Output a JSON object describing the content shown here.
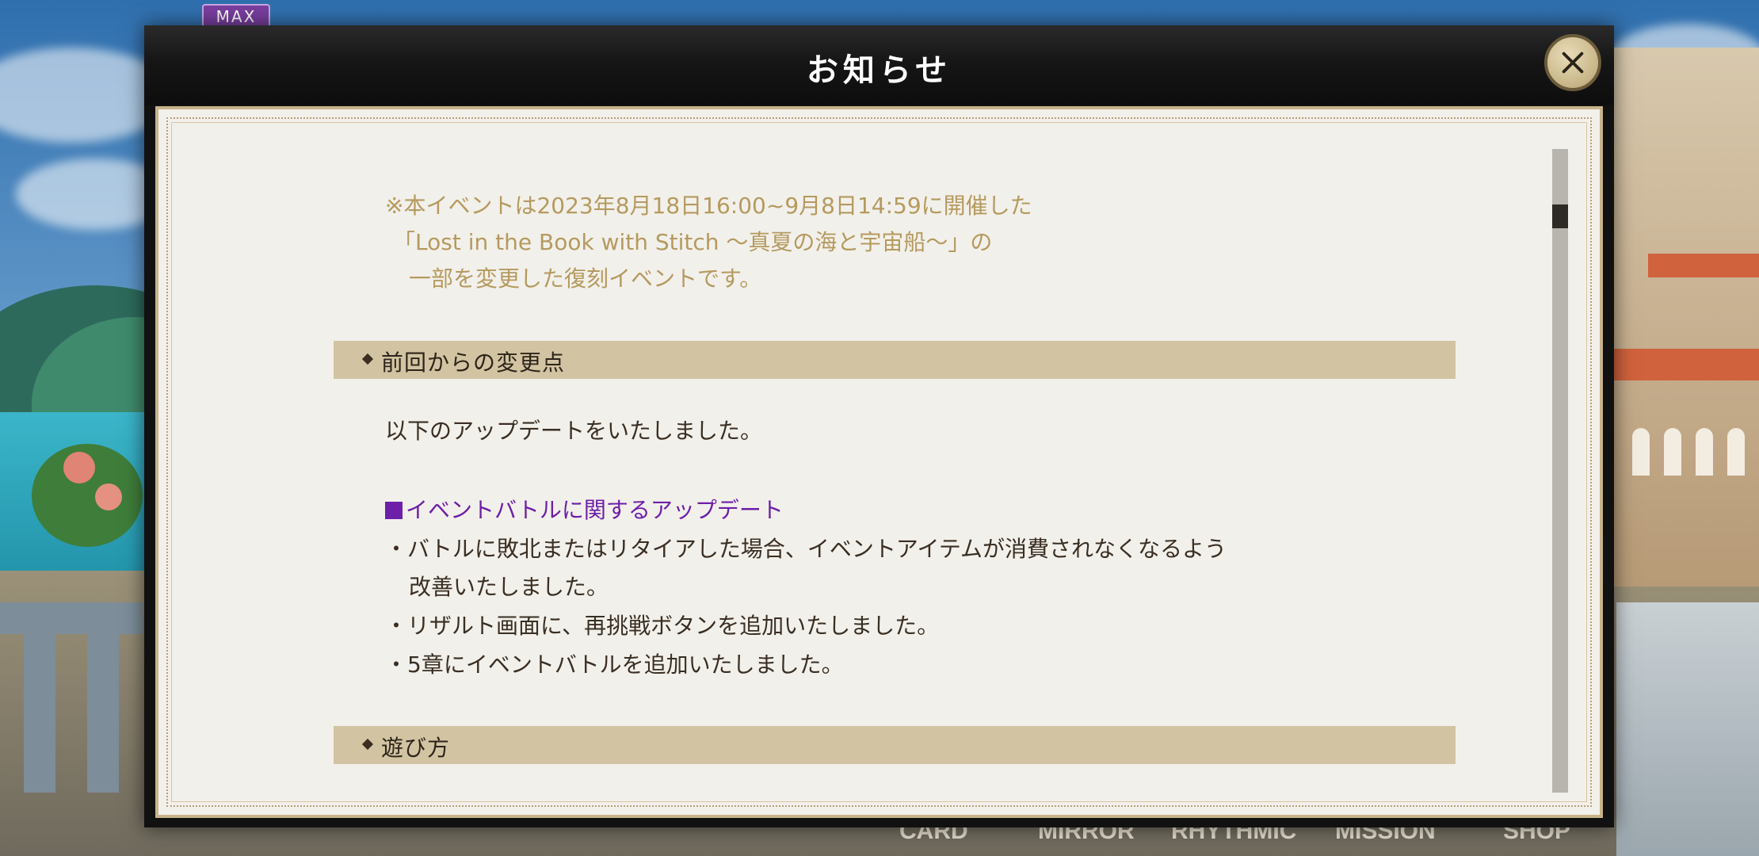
{
  "badge": {
    "max": "MAX"
  },
  "bottom_nav": {
    "items": [
      "CARD",
      "MIRROR",
      "RHYTHMIC",
      "MISSION",
      "SHOP"
    ]
  },
  "dialog": {
    "title": "お知らせ",
    "close_icon": "close-icon",
    "note_lines": [
      "※本イベントは2023年8月18日16:00~9月8日14:59に開催した",
      "「Lost in the Book with Stitch 〜真夏の海と宇宙船〜」の",
      "一部を変更した復刻イベントです。"
    ],
    "sections": [
      {
        "heading": "前回からの変更点"
      },
      {
        "heading": "遊び方"
      }
    ],
    "intro": "以下のアップデートをいたしました。",
    "update_heading": "イベントバトルに関するアップデート",
    "bullets": [
      "・バトルに敗北またはリタイアした場合、イベントアイテムが消費されなくなるよう",
      "改善いたしました。",
      "・リザルト画面に、再挑戦ボタンを追加いたしました。",
      "・5章にイベントバトルを追加いたしました。"
    ]
  },
  "colors": {
    "note_text": "#b59a5e",
    "heading_bar": "#d2c4a2",
    "update_heading": "#6d1fa8",
    "paper": "#f2f0eb",
    "frame": "#c9b48a"
  }
}
